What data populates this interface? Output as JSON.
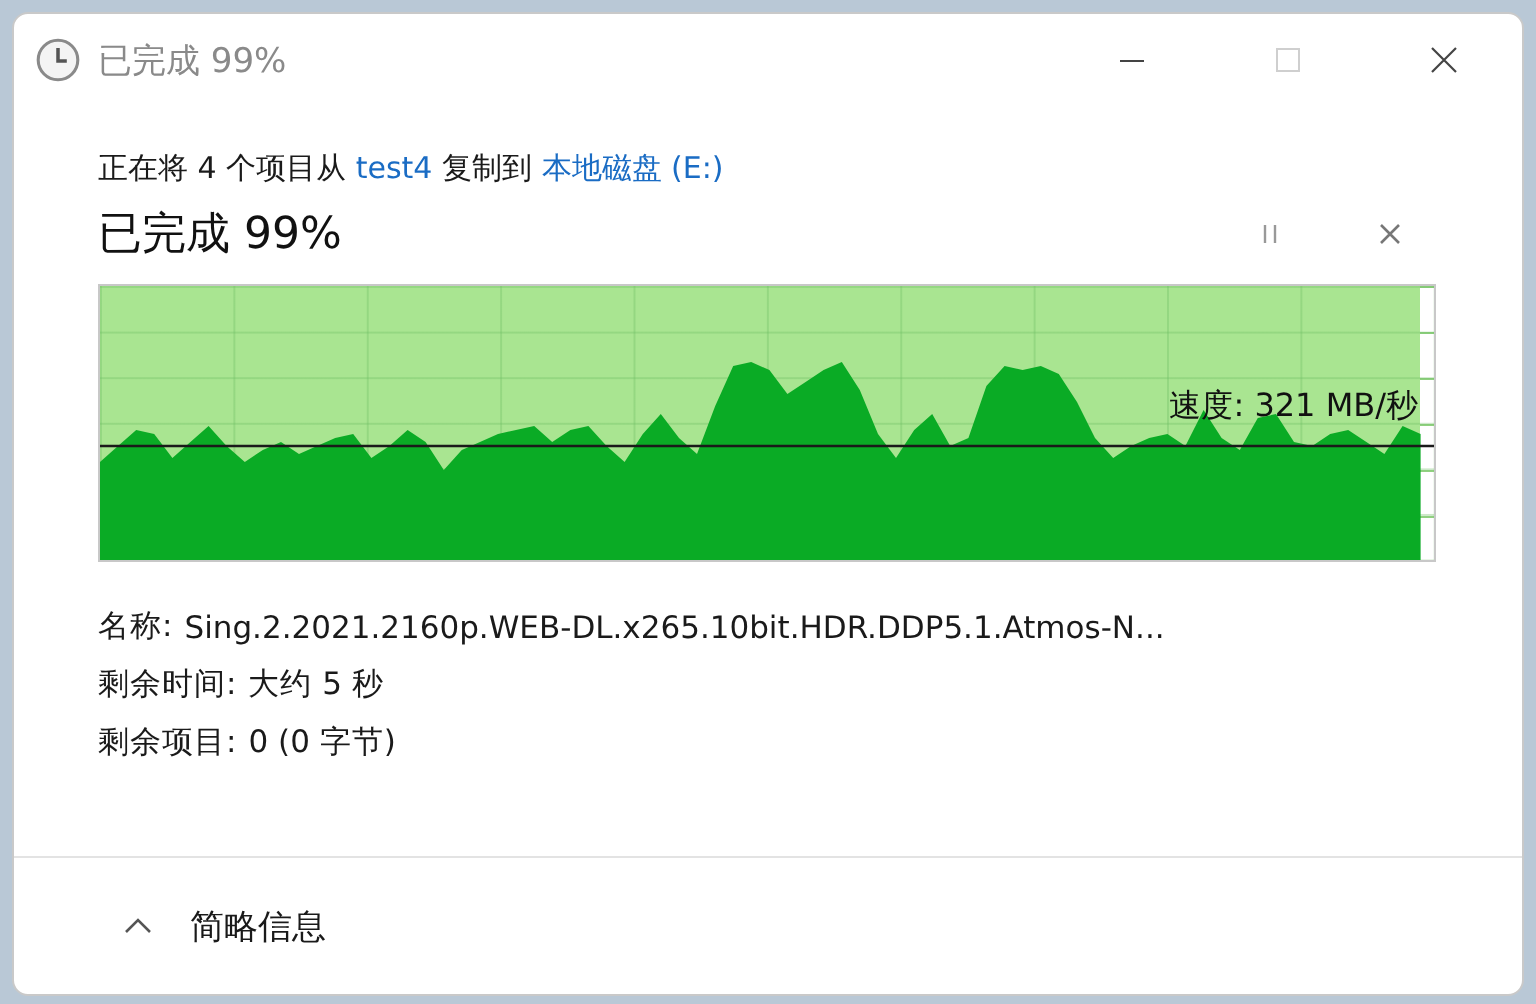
{
  "window": {
    "title": "已完成 99%",
    "controls": [
      {
        "kind": "minimize",
        "disabled": false
      },
      {
        "kind": "maximize",
        "disabled": true
      },
      {
        "kind": "close",
        "disabled": false
      }
    ]
  },
  "summary": {
    "prefix": "正在将 4 个项目从",
    "source": "test4",
    "middle": "复制到",
    "destination": "本地磁盘 (E:)"
  },
  "progress": {
    "heading": "已完成 99%",
    "level": 0.99,
    "speed": "速度: 321 MB/秒"
  },
  "details": [
    {
      "label": "名称:",
      "value": "Sing.2.2021.2160p.WEB-DL.x265.10bit.HDR.DDP5.1.Atmos-N..."
    },
    {
      "label": "剩余时间:",
      "value": "大约 5 秒"
    },
    {
      "label": "剩余项目:",
      "value": "0 (0 字节)"
    }
  ],
  "footer": {
    "label": "简略信息",
    "expanded": true
  }
}
